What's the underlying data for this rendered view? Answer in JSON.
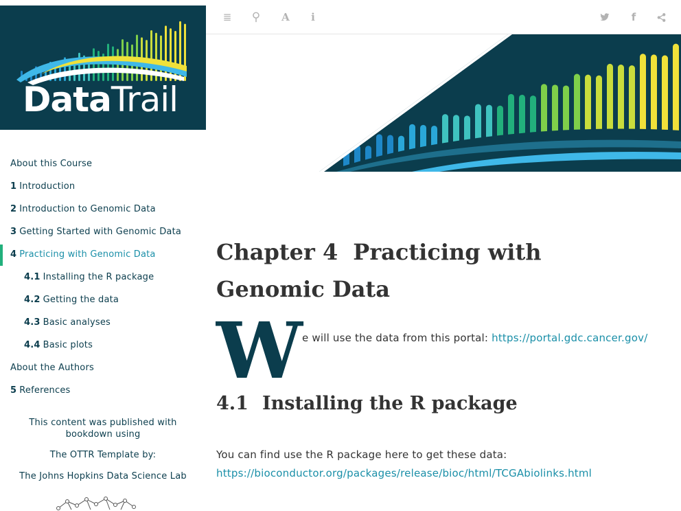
{
  "logo": {
    "text_bold": "Data",
    "text_light": "Trail"
  },
  "toolbar": {
    "left_icons": [
      "menu-icon",
      "search-icon",
      "font-icon",
      "info-icon"
    ],
    "right_icons": [
      "twitter-icon",
      "facebook-icon",
      "share-icon"
    ],
    "glyphs": {
      "menu": "≣",
      "search": "⚲",
      "font": "A",
      "info": "i",
      "twitter": "🐦",
      "facebook": "f",
      "share": "⋖"
    }
  },
  "sidebar": {
    "items": [
      {
        "num": "",
        "label": "About this Course"
      },
      {
        "num": "1",
        "label": "Introduction"
      },
      {
        "num": "2",
        "label": "Introduction to Genomic Data"
      },
      {
        "num": "3",
        "label": "Getting Started with Genomic Data"
      },
      {
        "num": "4",
        "label": "Practicing with Genomic Data",
        "active": true
      },
      {
        "num": "4.1",
        "label": "Installing the R package"
      },
      {
        "num": "4.2",
        "label": "Getting the data"
      },
      {
        "num": "4.3",
        "label": "Basic analyses"
      },
      {
        "num": "4.4",
        "label": "Basic plots"
      },
      {
        "num": "",
        "label": "About the Authors"
      },
      {
        "num": "5",
        "label": "References"
      }
    ],
    "published_note": "This content was published with bookdown using",
    "ottr_note": "The OTTR Template by:",
    "lab_note": "The Johns Hopkins Data Science Lab"
  },
  "content": {
    "chapter_num": "Chapter 4",
    "chapter_title": "Practicing with Genomic Data",
    "dropcap": "W",
    "intro_text": "e will use the data from this portal: ",
    "intro_link": "https://portal.gdc.cancer.gov/",
    "section_num": "4.1",
    "section_title": "Installing the R package",
    "para_text": "You can find use the R package here to get these data:",
    "para_link": "https://bioconductor.org/packages/release/bioc/html/TCGAbiolinks.html"
  },
  "colors": {
    "brand_dark": "#0b3d4d",
    "link": "#1a8fa8",
    "active_bar": "#22b07c",
    "toolbar_icon": "#b3b3b3"
  }
}
